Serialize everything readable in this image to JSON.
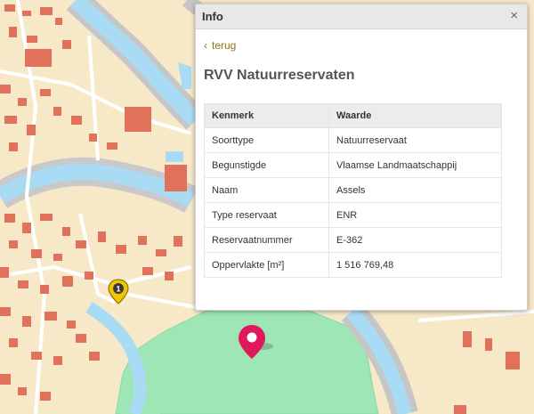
{
  "panel": {
    "title": "Info",
    "close_symbol": "×",
    "back_label": "terug",
    "layer_title": "RVV Natuurreservaten",
    "table": {
      "headers": [
        "Kenmerk",
        "Waarde"
      ],
      "rows": [
        [
          "Soorttype",
          "Natuurreservaat"
        ],
        [
          "Begunstigde",
          "Vlaamse Landmaatschappij"
        ],
        [
          "Naam",
          "Assels"
        ],
        [
          "Type reservaat",
          "ENR"
        ],
        [
          "Reservaatnummer",
          "E-362"
        ],
        [
          "Oppervlakte [m²]",
          "1 516 769,48"
        ]
      ]
    }
  },
  "map": {
    "cluster_marker_label": "1",
    "colors": {
      "land": "#f7e9c8",
      "buildings": "#e0715a",
      "water": "#a9dbf4",
      "roads": "#ffffff",
      "reserve": "#9ee6b6",
      "pin": "#e0185c",
      "cluster_pin": "#f2c500"
    }
  }
}
